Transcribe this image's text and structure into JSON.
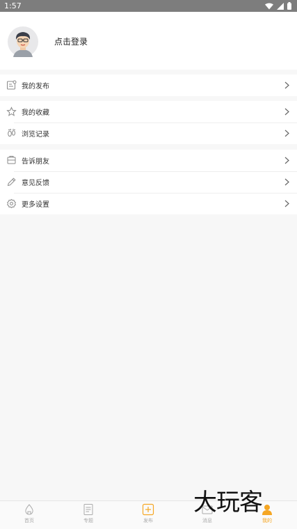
{
  "status": {
    "time": "1:57"
  },
  "profile": {
    "login_prompt": "点击登录"
  },
  "menu": {
    "section1": [
      {
        "label": "我的发布",
        "icon": "publish-icon"
      }
    ],
    "section2": [
      {
        "label": "我的收藏",
        "icon": "star-icon"
      },
      {
        "label": "浏览记录",
        "icon": "footprint-icon"
      }
    ],
    "section3": [
      {
        "label": "告诉朋友",
        "icon": "share-icon"
      },
      {
        "label": "意见反馈",
        "icon": "pencil-icon"
      },
      {
        "label": "更多设置",
        "icon": "gear-icon"
      }
    ]
  },
  "tabbar": {
    "items": [
      {
        "label": "首页",
        "icon": "home-icon"
      },
      {
        "label": "专题",
        "icon": "document-icon"
      },
      {
        "label": "发布",
        "icon": "add-icon"
      },
      {
        "label": "消息",
        "icon": "mail-icon"
      },
      {
        "label": "我的",
        "icon": "user-icon"
      }
    ],
    "active_index": 4,
    "active_color": "#f5a623",
    "inactive_color": "#aaaaaa"
  },
  "watermark": {
    "text": "大玩客"
  }
}
